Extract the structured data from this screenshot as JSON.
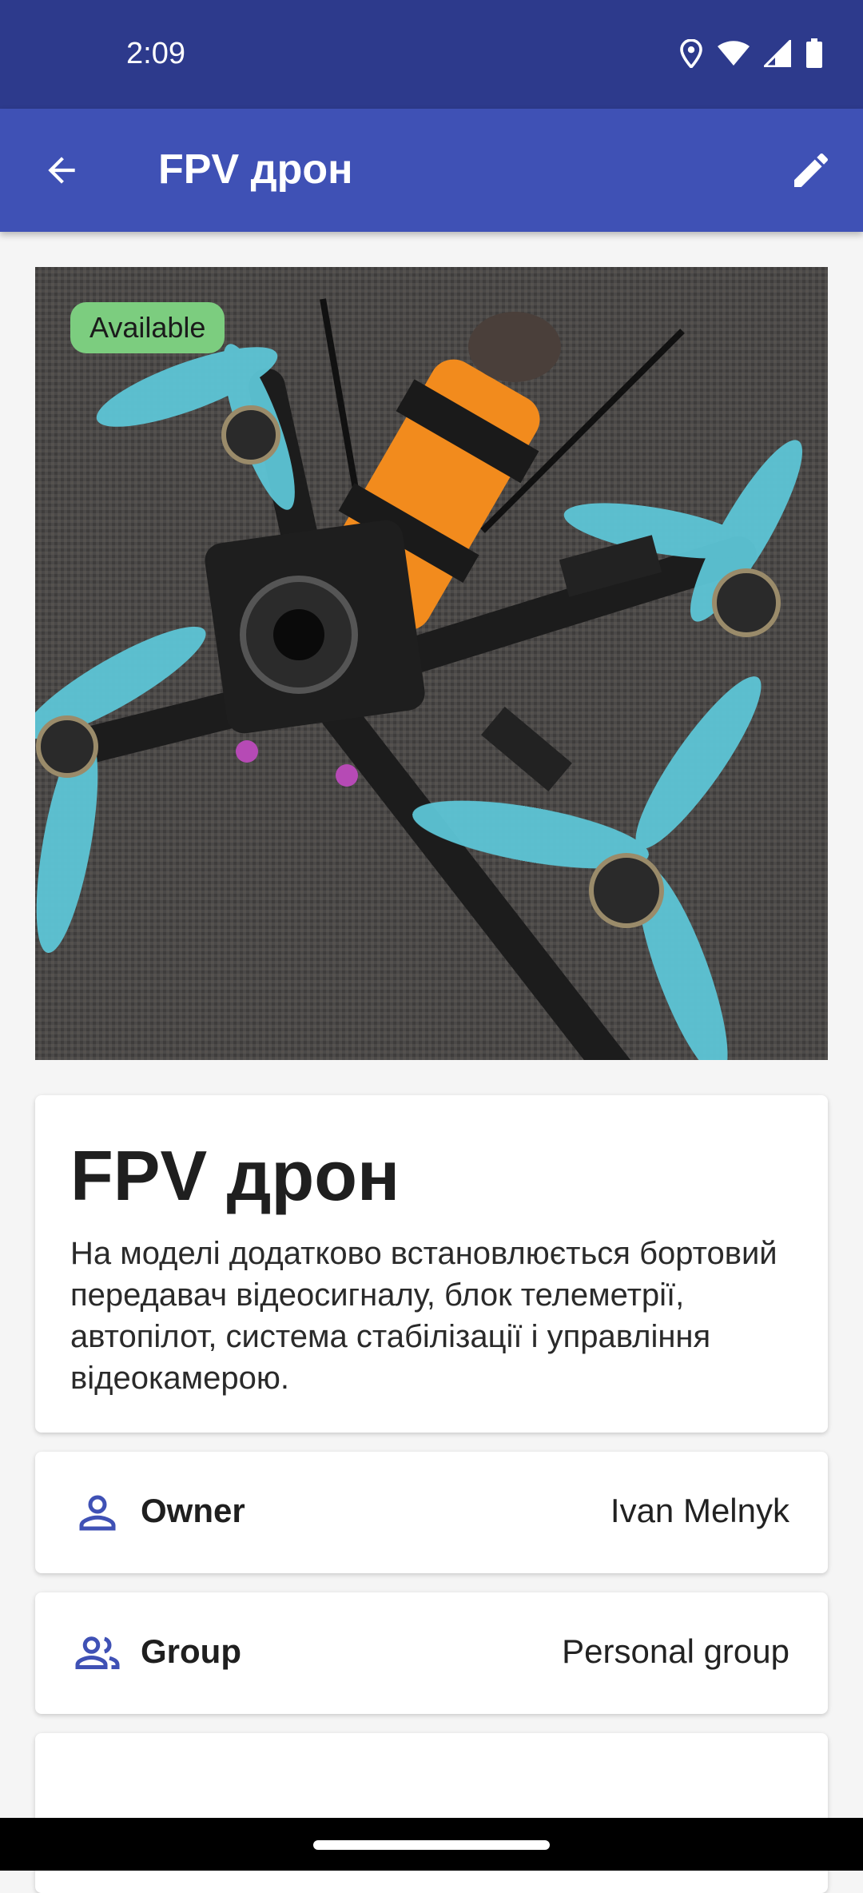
{
  "status_bar": {
    "time": "2:09",
    "icons": [
      "location-icon",
      "wifi-icon",
      "signal-icon",
      "battery-icon"
    ]
  },
  "app_bar": {
    "title": "FPV дрон",
    "back_icon": "arrow-back-icon",
    "edit_icon": "pencil-edit-icon"
  },
  "hero": {
    "badge": "Available",
    "badge_color": "#7ccd7f"
  },
  "details": {
    "title": "FPV дрон",
    "description": "На моделі додатково встановлюється бортовий передавач відеосигналу, блок телеметрії, автопілот, система стабілізації і управління відеокамерою."
  },
  "owner": {
    "label": "Owner",
    "value": "Ivan Melnyk",
    "icon": "person-icon"
  },
  "group": {
    "label": "Group",
    "value": "Personal group",
    "icon": "people-group-icon"
  },
  "colors": {
    "status_bar": "#2d3a8c",
    "app_bar": "#3f51b5",
    "accent_icon": "#3f51b5"
  }
}
